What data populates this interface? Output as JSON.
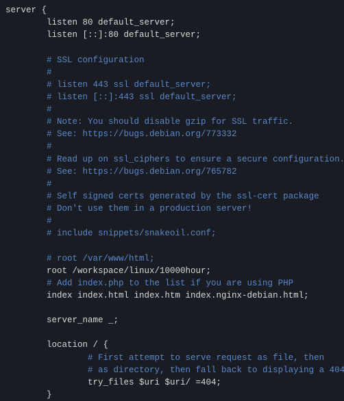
{
  "lines": [
    {
      "cls": "p",
      "text": "server {"
    },
    {
      "cls": "p",
      "text": "        listen 80 default_server;"
    },
    {
      "cls": "p",
      "text": "        listen [::]:80 default_server;"
    },
    {
      "cls": "p",
      "text": ""
    },
    {
      "cls": "c",
      "text": "        # SSL configuration"
    },
    {
      "cls": "c",
      "text": "        #"
    },
    {
      "cls": "c",
      "text": "        # listen 443 ssl default_server;"
    },
    {
      "cls": "c",
      "text": "        # listen [::]:443 ssl default_server;"
    },
    {
      "cls": "c",
      "text": "        #"
    },
    {
      "cls": "c",
      "text": "        # Note: You should disable gzip for SSL traffic."
    },
    {
      "cls": "c",
      "text": "        # See: https://bugs.debian.org/773332"
    },
    {
      "cls": "c",
      "text": "        #"
    },
    {
      "cls": "c",
      "text": "        # Read up on ssl_ciphers to ensure a secure configuration."
    },
    {
      "cls": "c",
      "text": "        # See: https://bugs.debian.org/765782"
    },
    {
      "cls": "c",
      "text": "        #"
    },
    {
      "cls": "c",
      "text": "        # Self signed certs generated by the ssl-cert package"
    },
    {
      "cls": "c",
      "text": "        # Don't use them in a production server!"
    },
    {
      "cls": "c",
      "text": "        #"
    },
    {
      "cls": "c",
      "text": "        # include snippets/snakeoil.conf;"
    },
    {
      "cls": "p",
      "text": ""
    },
    {
      "cls": "c",
      "text": "        # root /var/www/html;"
    },
    {
      "cls": "p",
      "text": "        root /workspace/linux/10000hour;"
    },
    {
      "cls": "c",
      "text": "        # Add index.php to the list if you are using PHP"
    },
    {
      "cls": "p",
      "text": "        index index.html index.htm index.nginx-debian.html;"
    },
    {
      "cls": "p",
      "text": ""
    },
    {
      "cls": "p",
      "text": "        server_name _;"
    },
    {
      "cls": "p",
      "text": ""
    },
    {
      "cls": "p",
      "text": "        location / {"
    },
    {
      "cls": "c",
      "text": "                # First attempt to serve request as file, then"
    },
    {
      "cls": "c",
      "text": "                # as directory, then fall back to displaying a 404."
    },
    {
      "cls": "p",
      "text": "                try_files $uri $uri/ =404;"
    },
    {
      "cls": "p",
      "text": "        }"
    }
  ]
}
